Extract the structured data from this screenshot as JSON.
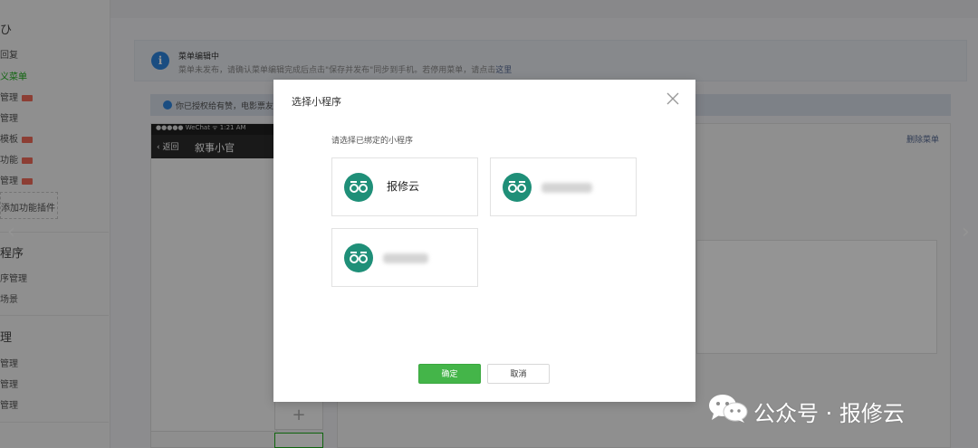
{
  "sidebar": {
    "items": [
      {
        "label": "ひ",
        "kind": "head"
      },
      {
        "label": "回复"
      },
      {
        "label": "义菜单",
        "active": true
      },
      {
        "label": "管理",
        "badge": true
      },
      {
        "label": "管理"
      },
      {
        "label": "模板",
        "badge": true
      },
      {
        "label": "功能",
        "badge": true
      },
      {
        "label": "管理",
        "badge": true
      }
    ],
    "add_plugin_label": "添加功能插件",
    "section2_title": "程序",
    "section2_items": [
      "序管理",
      "场景"
    ],
    "section3_title": "理",
    "section3_items": [
      "管理",
      "管理",
      "管理"
    ]
  },
  "notice": {
    "title": "菜单编辑中",
    "text": "菜单未发布，请确认菜单编辑完成后点击\"保存并发布\"同步到手机。若停用菜单，请点击",
    "link": "这里"
  },
  "info_bar": {
    "text": "你已授权给有赞，电影票友"
  },
  "phone": {
    "status": "●●●●● WeChat ᯤ        1:21 AM",
    "back_label": "返回",
    "title": "叙事小官"
  },
  "edit_panel": {
    "delete_label": "删除菜单"
  },
  "plus_label": "+",
  "modal": {
    "title": "选择小程序",
    "subtitle": "请选择已绑定的小程序",
    "apps": [
      {
        "name": "报修云"
      },
      {
        "name": ""
      },
      {
        "name": ""
      }
    ],
    "confirm_label": "确定",
    "cancel_label": "取消"
  },
  "nav": {
    "prev_arrow": "‹",
    "next_arrow": "›"
  },
  "watermark": {
    "text": "公众号 · 报修云"
  },
  "colors": {
    "accent_green": "#44b549",
    "app_icon": "#1f8f78",
    "link_blue": "#576b95"
  }
}
